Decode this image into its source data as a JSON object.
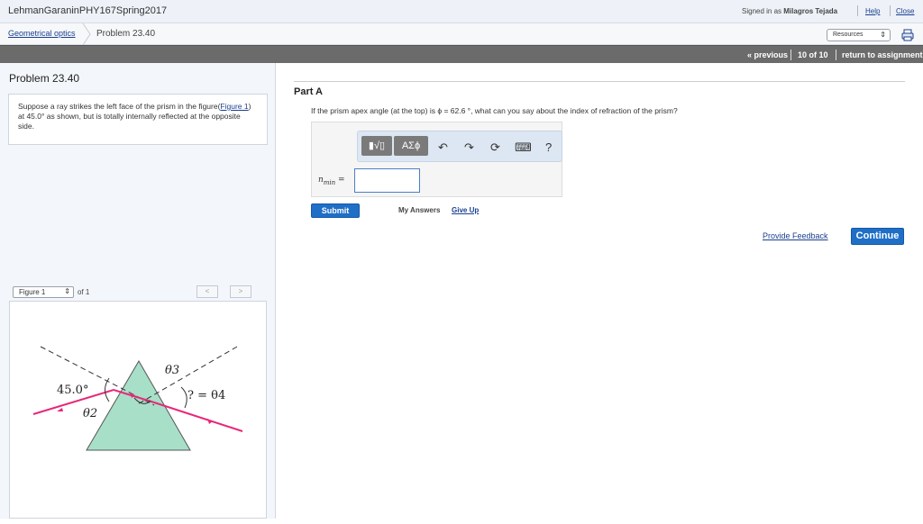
{
  "header": {
    "course_title": "LehmanGaraninPHY167Spring2017",
    "signed_in_prefix": "Signed in as",
    "user_name": "Milagros Tejada",
    "help_label": "Help",
    "close_label": "Close"
  },
  "breadcrumb": {
    "parent_label": "Geometrical optics",
    "current_label": "Problem 23.40"
  },
  "resources": {
    "selected": "Resources",
    "icon": "print-icon"
  },
  "nav": {
    "previous_label": "« previous",
    "position": "10 of 10",
    "return_label": "return to assignment"
  },
  "problem": {
    "title": "Problem 23.40",
    "text_before_link": "Suppose a ray strikes the left face of the prism in the figure(",
    "link_label": "Figure 1",
    "text_after_link": ") at 45.0° as shown, but is totally internally reflected at the opposite side."
  },
  "figure_nav": {
    "selected": "Figure 1",
    "of_label": "of 1",
    "prev_glyph": "<",
    "next_glyph": ">"
  },
  "figure": {
    "angle_label": "45.0°",
    "theta2": "θ2",
    "theta3": "θ3",
    "theta4_label": "? = θ4",
    "prism_color": "#a8dfc8",
    "ray_color": "#e8287a"
  },
  "part": {
    "label": "Part A",
    "question": "If the prism apex angle (at the top) is ϕ = 62.6 °, what can you say about the index of refraction of the prism?"
  },
  "toolbar": {
    "btn1_label": "▮√▯",
    "btn2_label": "ΑΣϕ",
    "undo_icon": "↶",
    "redo_icon": "↷",
    "reset_icon": "⟳",
    "keyboard_icon": "⌨",
    "help_icon": "?"
  },
  "answer": {
    "var_main": "n",
    "var_sub": "min",
    "equals": " =",
    "value": ""
  },
  "actions": {
    "submit_label": "Submit",
    "my_answers_label": "My Answers",
    "give_up_label": "Give Up",
    "feedback_label": "Provide Feedback",
    "continue_label": "Continue"
  },
  "colors": {
    "accent": "#1f6fc7",
    "navbar": "#6b6b6b",
    "link": "#1a3f8f"
  }
}
